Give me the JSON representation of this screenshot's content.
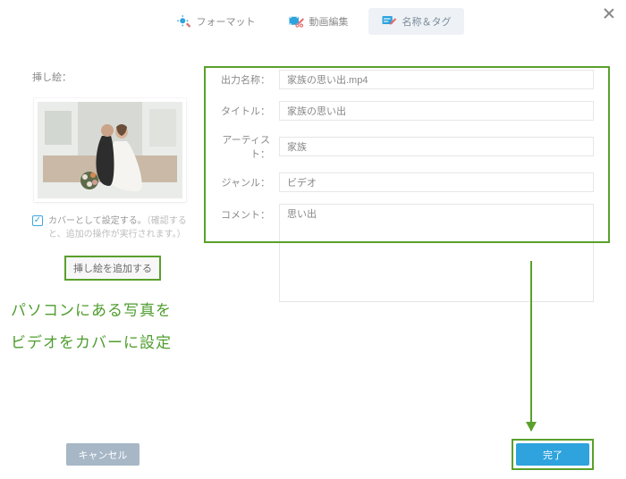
{
  "tabs": {
    "format": "フォーマット",
    "videoEdit": "動画編集",
    "nameTag": "名称＆タグ"
  },
  "left": {
    "sectionTitle": "挿し絵：",
    "checkboxLabel": "カバーとして設定する。",
    "checkboxTip": "（確認すると、追加の操作が実行されます。）",
    "addButton": "挿し絵を追加する"
  },
  "annotation": {
    "line1": "パソコンにある写真を",
    "line2": "ビデオをカバーに設定"
  },
  "form": {
    "outputName": {
      "label": "出力名称：",
      "value": "家族の思い出.mp4"
    },
    "title": {
      "label": "タイトル：",
      "value": "家族の思い出"
    },
    "artist": {
      "label": "アーティスト：",
      "value": "家族"
    },
    "genre": {
      "label": "ジャンル：",
      "value": "ビデオ"
    },
    "comment": {
      "label": "コメント：",
      "value": "思い出"
    }
  },
  "footer": {
    "cancel": "キャンセル",
    "ok": "完了"
  }
}
